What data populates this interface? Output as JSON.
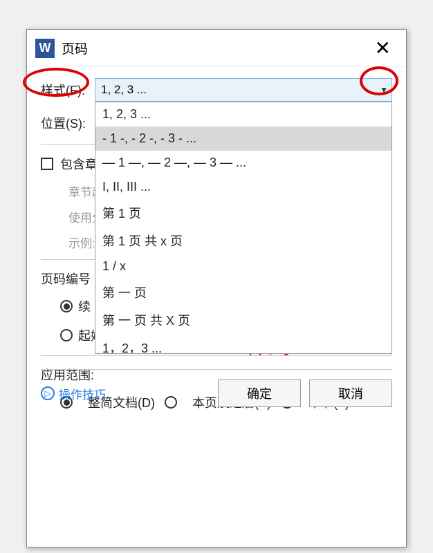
{
  "dialog": {
    "app_letter": "W",
    "title": "页码"
  },
  "format": {
    "label": "样式(F):",
    "selected": "1, 2, 3 ...",
    "options": [
      "1, 2, 3 ...",
      "- 1 -, - 2 -, - 3 - ...",
      "— 1 —, — 2 —, — 3 — ...",
      "I, II, III ...",
      "第 1 页",
      "第 1 页 共 x 页",
      "1 / x",
      "第 一 页",
      "第 一 页 共 X 页",
      "1，2，3 ..."
    ]
  },
  "position": {
    "label": "位置(S):"
  },
  "include_chapter": {
    "label": "包含章",
    "section_start": "章节起",
    "use_sep": "使用分",
    "example": "示例:"
  },
  "page_numbering": {
    "title": "页码编号",
    "continue": "续",
    "start_at": "起始页码(A):"
  },
  "apply_to": {
    "title": "应用范围:",
    "whole": "整简文档(D)",
    "from_here": "本页及之后(P)",
    "this_section": "本节(T)"
  },
  "footer": {
    "tips": "操作技巧",
    "ok": "确定",
    "cancel": "取消"
  },
  "annotation": {
    "text": "样式"
  }
}
